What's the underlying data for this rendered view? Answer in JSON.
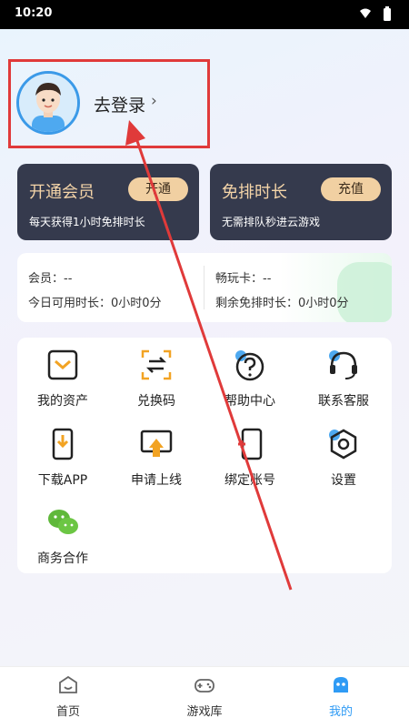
{
  "status_bar": {
    "time": "10:20"
  },
  "profile": {
    "login_label": "去登录",
    "chevron": "›"
  },
  "cards": {
    "vip": {
      "title": "开通会员",
      "button": "开通",
      "desc": "每天获得1小时免排时长"
    },
    "skip": {
      "title": "免排时长",
      "button": "充值",
      "desc": "无需排队秒进云游戏"
    }
  },
  "member_info": {
    "member": "会员：--",
    "today_time": "今日可用时长：0小时0分",
    "play_card": "畅玩卡：--",
    "remaining": "剩余免排时长：0小时0分"
  },
  "menu": {
    "items": [
      {
        "label": "我的资产",
        "icon": "wallet-icon"
      },
      {
        "label": "兑换码",
        "icon": "scan-exchange-icon"
      },
      {
        "label": "帮助中心",
        "icon": "help-icon"
      },
      {
        "label": "联系客服",
        "icon": "headset-icon"
      },
      {
        "label": "下载APP",
        "icon": "phone-download-icon"
      },
      {
        "label": "申请上线",
        "icon": "upload-screen-icon"
      },
      {
        "label": "绑定账号",
        "icon": "link-phone-icon"
      },
      {
        "label": "设置",
        "icon": "settings-icon"
      },
      {
        "label": "商务合作",
        "icon": "wechat-icon"
      }
    ]
  },
  "bottom_nav": {
    "items": [
      {
        "label": "首页",
        "icon": "home-icon"
      },
      {
        "label": "游戏库",
        "icon": "gamepad-icon"
      },
      {
        "label": "我的",
        "icon": "profile-mascot-icon",
        "active": true
      }
    ]
  },
  "colors": {
    "accent": "#2f9bf5",
    "card_bg": "#353a4d",
    "gold": "#f1d0a2",
    "annotation": "#e03a3a"
  }
}
